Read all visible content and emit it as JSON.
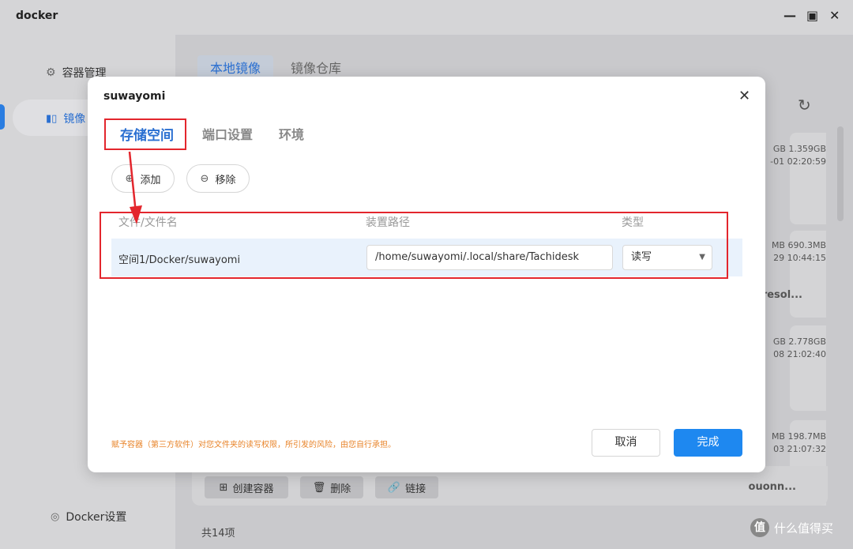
{
  "window": {
    "title": "docker",
    "minimize_icon": "minimize-icon",
    "maximize_icon": "maximize-icon",
    "close_icon": "close-icon"
  },
  "sidebar": {
    "items": [
      {
        "label": "容器管理",
        "icon": "gear-icon"
      },
      {
        "label": "镜像",
        "icon": "image-icon"
      }
    ],
    "settings_label": "Docker设置"
  },
  "main": {
    "tabs": [
      {
        "label": "本地镜像"
      },
      {
        "label": "镜像仓库"
      }
    ],
    "cards": [
      {
        "meta1": "GB 1.359GB",
        "meta2": "-01 02:20:59",
        "name": ""
      },
      {
        "meta1": "MB 690.3MB",
        "meta2": "29 10:44:15",
        "name": "resol..."
      },
      {
        "meta1": "GB 2.778GB",
        "meta2": "08 21:02:40",
        "name": ""
      },
      {
        "meta1": "MB 198.7MB",
        "meta2": "03 21:07:32",
        "name": "ouonn..."
      }
    ],
    "actions": {
      "create": "创建容器",
      "delete": "删除",
      "link": "链接"
    },
    "count": "共14项"
  },
  "modal": {
    "title": "suwayomi",
    "tabs": [
      {
        "label": "存储空间"
      },
      {
        "label": "端口设置"
      },
      {
        "label": "环境"
      }
    ],
    "add_label": "添加",
    "remove_label": "移除",
    "columns": {
      "file": "文件/文件名",
      "mount": "装置路径",
      "type": "类型"
    },
    "rows": [
      {
        "file": "空间1/Docker/suwayomi",
        "mount": "/home/suwayomi/.local/share/Tachidesk",
        "type": "读写"
      }
    ],
    "note": "赋予容器（第三方软件）对您文件夹的读写权限，所引发的风险，由您自行承担。",
    "cancel_label": "取消",
    "ok_label": "完成"
  },
  "watermark": {
    "text": "什么值得买",
    "badge": "值"
  },
  "colors": {
    "accent": "#1e88f0",
    "annotation": "#e3262d",
    "warning": "#e8842a"
  }
}
